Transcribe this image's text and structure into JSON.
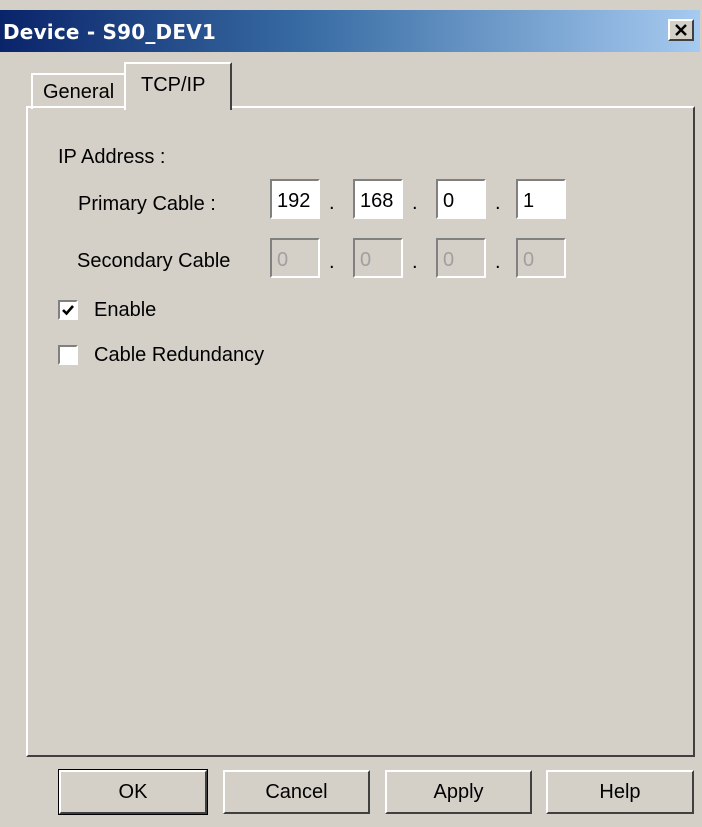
{
  "window": {
    "title": "Device - S90_DEV1",
    "close_icon": "close-icon"
  },
  "tabs": [
    {
      "label": "General",
      "active": false
    },
    {
      "label": "TCP/IP",
      "active": true
    }
  ],
  "ip_section": {
    "heading": "IP Address :",
    "primary": {
      "label": "Primary Cable :",
      "octets": [
        "192",
        "168",
        "0",
        "1"
      ],
      "enabled": true
    },
    "secondary": {
      "label": "Secondary Cable",
      "octets": [
        "0",
        "0",
        "0",
        "0"
      ],
      "enabled": false
    },
    "separator": "."
  },
  "options": {
    "enable": {
      "label": "Enable",
      "checked": true
    },
    "cable_redundancy": {
      "label": "Cable Redundancy",
      "checked": false
    }
  },
  "buttons": {
    "ok": "OK",
    "cancel": "Cancel",
    "apply": "Apply",
    "help": "Help"
  }
}
